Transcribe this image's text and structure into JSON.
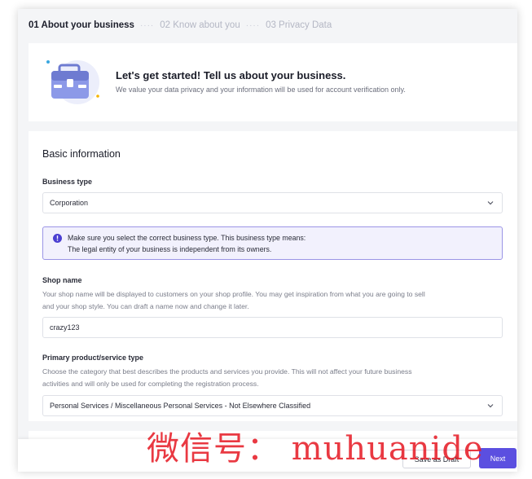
{
  "stepper": {
    "steps": [
      {
        "label": "01 About your business"
      },
      {
        "label": "02 Know about you"
      },
      {
        "label": "03 Privacy Data"
      }
    ],
    "separator": "····"
  },
  "hero": {
    "icon": "briefcase-illustration",
    "title": "Let's get started! Tell us about your business.",
    "subtitle": "We value your data privacy and your information will be used for account verification only."
  },
  "form": {
    "section_title": "Basic information",
    "business_type": {
      "label": "Business type",
      "value": "Corporation",
      "notice_line1": "Make sure you select the correct business type. This business type means:",
      "notice_line2": "The legal entity of your business is independent from its owners."
    },
    "shop_name": {
      "label": "Shop name",
      "helper_line1": "Your shop name will be displayed to customers on your shop profile. You may get inspiration from what you are going to sell",
      "helper_line2": "and your shop style. You can draft a name now and change it later.",
      "value": "crazy123"
    },
    "primary_type": {
      "label": "Primary product/service type",
      "helper_line1": "Choose the category that best describes the products and services you provide. This will not affect your future business",
      "helper_line2": "activities and will only be used for completing the registration process.",
      "value": "Personal Services / Miscellaneous Personal Services - Not Elsewhere Classified"
    }
  },
  "footer": {
    "save_draft": "Save as Draft",
    "next": "Next"
  },
  "watermark": "微信号： muhuanide",
  "colors": {
    "accent": "#5b4fe0",
    "notice_border": "#9b95e6",
    "notice_bg": "#f2f1fd",
    "watermark": "#e61e28"
  }
}
